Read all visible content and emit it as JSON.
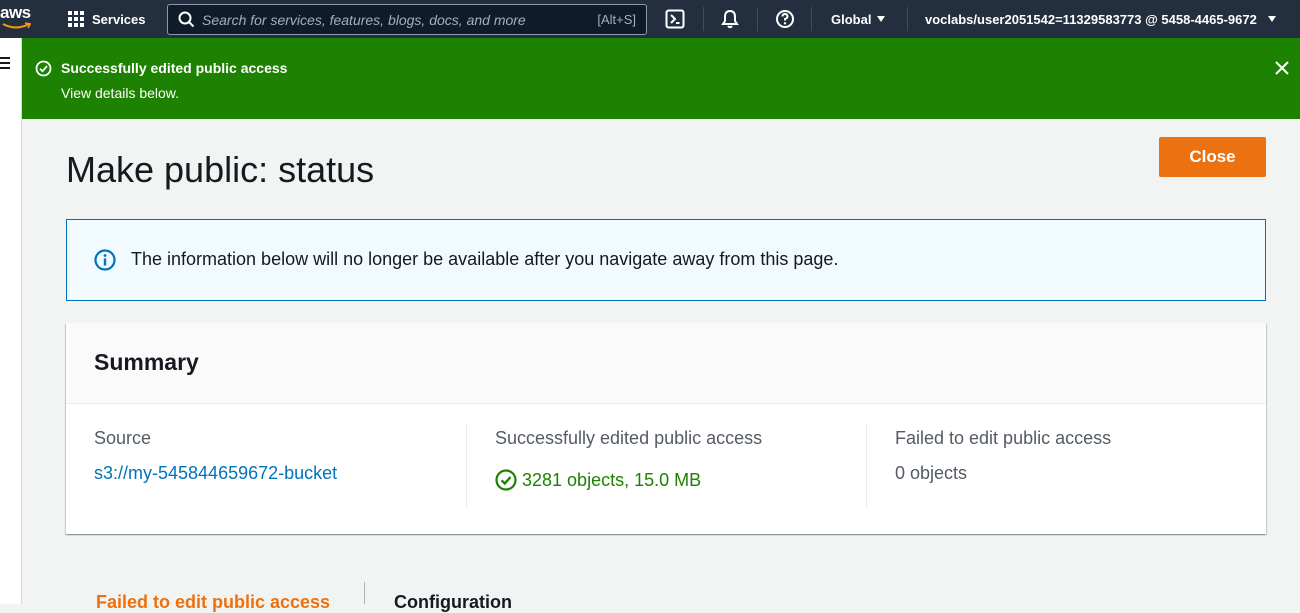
{
  "nav": {
    "logo_text": "aws",
    "services_label": "Services",
    "search_placeholder": "Search for services, features, blogs, docs, and more",
    "search_shortcut": "[Alt+S]",
    "region": "Global",
    "account": "voclabs/user2051542=11329583773 @ 5458-4465-9672"
  },
  "flash": {
    "title": "Successfully edited public access",
    "subtitle": "View details below."
  },
  "page": {
    "title": "Make public: status",
    "close_label": "Close"
  },
  "info": {
    "message": "The information below will no longer be available after you navigate away from this page."
  },
  "summary": {
    "heading": "Summary",
    "source_label": "Source",
    "source_value": "s3://my-545844659672-bucket",
    "success_label": "Successfully edited public access",
    "success_value": "3281 objects, 15.0 MB",
    "failed_label": "Failed to edit public access",
    "failed_value": "0 objects"
  },
  "tabs": [
    {
      "label": "Failed to edit public access",
      "active": true
    },
    {
      "label": "Configuration",
      "active": false
    }
  ],
  "colors": {
    "nav_bg": "#232f3e",
    "success_green": "#1d8102",
    "accent_orange": "#ec7211",
    "link_blue": "#0073bb"
  }
}
